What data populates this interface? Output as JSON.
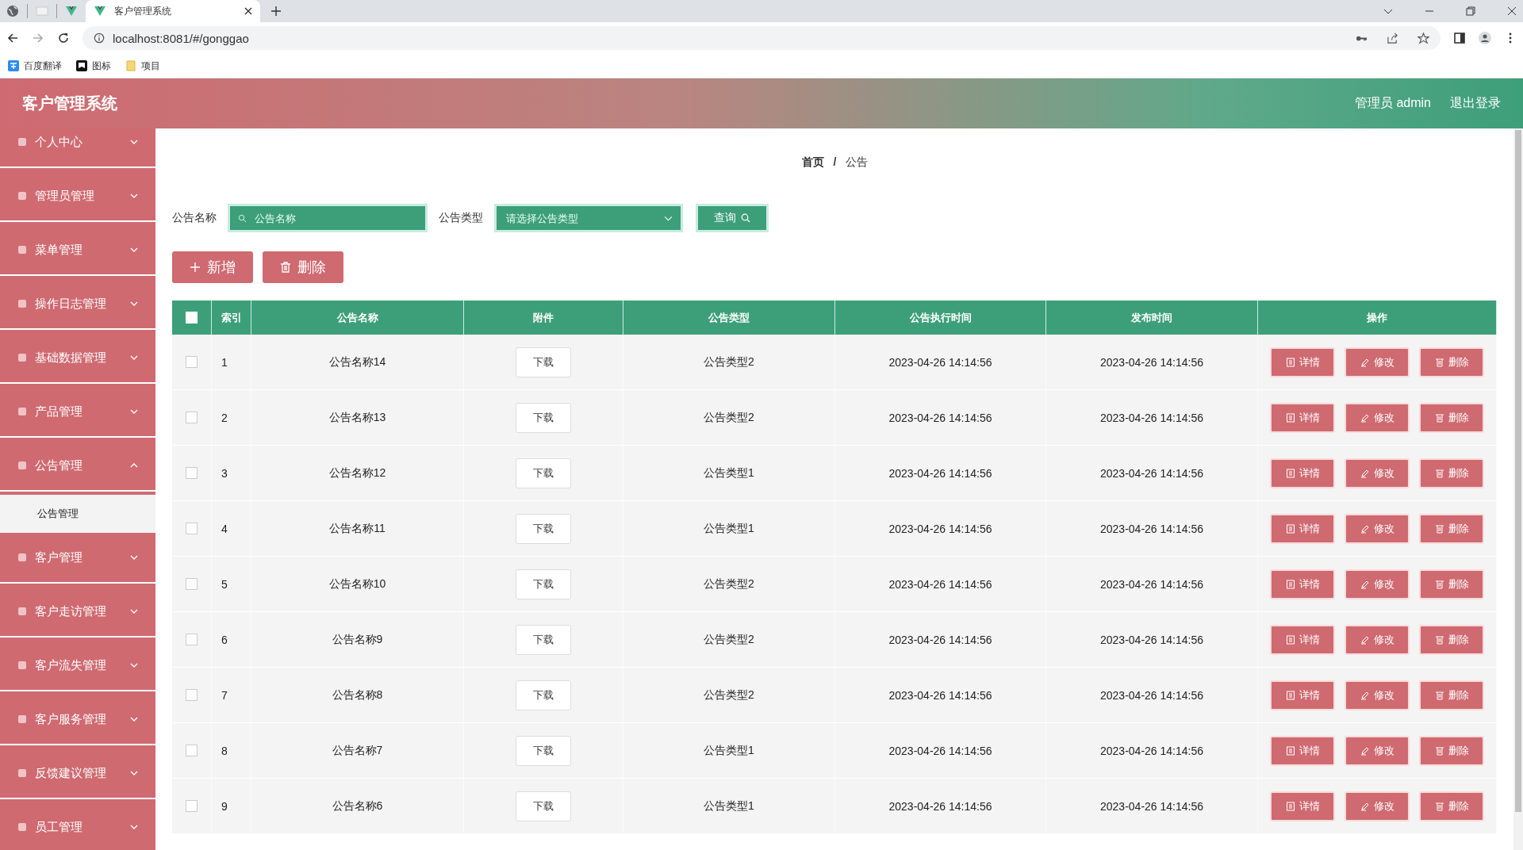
{
  "browser": {
    "tabs": [
      {
        "title": "客户管理系统",
        "selected": true
      }
    ],
    "url": "localhost:8081/#/gonggao",
    "bookmarks": [
      {
        "label": "百度翻译",
        "kind": "translate"
      },
      {
        "label": "图标",
        "kind": "flag"
      },
      {
        "label": "项目",
        "kind": "folder"
      }
    ]
  },
  "header": {
    "title": "客户管理系统",
    "user": "管理员 admin",
    "logout": "退出登录"
  },
  "sidebar": {
    "items": [
      {
        "label": "个人中心",
        "expanded": false
      },
      {
        "label": "管理员管理",
        "expanded": false
      },
      {
        "label": "菜单管理",
        "expanded": false
      },
      {
        "label": "操作日志管理",
        "expanded": false
      },
      {
        "label": "基础数据管理",
        "expanded": false
      },
      {
        "label": "产品管理",
        "expanded": false
      },
      {
        "label": "公告管理",
        "expanded": true,
        "children": [
          {
            "label": "公告管理",
            "selected": true
          }
        ]
      },
      {
        "label": "客户管理",
        "expanded": false
      },
      {
        "label": "客户走访管理",
        "expanded": false
      },
      {
        "label": "客户流失管理",
        "expanded": false
      },
      {
        "label": "客户服务管理",
        "expanded": false
      },
      {
        "label": "反馈建议管理",
        "expanded": false
      },
      {
        "label": "员工管理",
        "expanded": false
      }
    ]
  },
  "breadcrumb": {
    "items": [
      "首页",
      "公告"
    ],
    "separator": "/"
  },
  "search": {
    "fields": [
      {
        "label": "公告名称",
        "placeholder": "公告名称",
        "kind": "text"
      },
      {
        "label": "公告类型",
        "placeholder": "请选择公告类型",
        "kind": "select"
      }
    ],
    "button": "查询"
  },
  "actions": [
    {
      "label": "新增",
      "kind": "add"
    },
    {
      "label": "删除",
      "kind": "delete"
    }
  ],
  "table": {
    "columns": [
      "索引",
      "公告名称",
      "附件",
      "公告类型",
      "公告执行时间",
      "发布时间",
      "操作"
    ],
    "header_checked": false,
    "rows": [
      {
        "checked": false,
        "index": "1",
        "name": "公告名称14",
        "file": "下载",
        "type": "公告类型2",
        "exec": "2023-04-26 14:14:56",
        "pub": "2023-04-26 14:14:56",
        "ops": [
          "详情",
          "修改",
          "删除"
        ]
      },
      {
        "checked": false,
        "index": "2",
        "name": "公告名称13",
        "file": "下载",
        "type": "公告类型2",
        "exec": "2023-04-26 14:14:56",
        "pub": "2023-04-26 14:14:56",
        "ops": [
          "详情",
          "修改",
          "删除"
        ]
      },
      {
        "checked": false,
        "index": "3",
        "name": "公告名称12",
        "file": "下载",
        "type": "公告类型1",
        "exec": "2023-04-26 14:14:56",
        "pub": "2023-04-26 14:14:56",
        "ops": [
          "详情",
          "修改",
          "删除"
        ]
      },
      {
        "checked": false,
        "index": "4",
        "name": "公告名称11",
        "file": "下载",
        "type": "公告类型1",
        "exec": "2023-04-26 14:14:56",
        "pub": "2023-04-26 14:14:56",
        "ops": [
          "详情",
          "修改",
          "删除"
        ]
      },
      {
        "checked": false,
        "index": "5",
        "name": "公告名称10",
        "file": "下载",
        "type": "公告类型2",
        "exec": "2023-04-26 14:14:56",
        "pub": "2023-04-26 14:14:56",
        "ops": [
          "详情",
          "修改",
          "删除"
        ]
      },
      {
        "checked": false,
        "index": "6",
        "name": "公告名称9",
        "file": "下载",
        "type": "公告类型2",
        "exec": "2023-04-26 14:14:56",
        "pub": "2023-04-26 14:14:56",
        "ops": [
          "详情",
          "修改",
          "删除"
        ]
      },
      {
        "checked": false,
        "index": "7",
        "name": "公告名称8",
        "file": "下载",
        "type": "公告类型2",
        "exec": "2023-04-26 14:14:56",
        "pub": "2023-04-26 14:14:56",
        "ops": [
          "详情",
          "修改",
          "删除"
        ]
      },
      {
        "checked": false,
        "index": "8",
        "name": "公告名称7",
        "file": "下载",
        "type": "公告类型1",
        "exec": "2023-04-26 14:14:56",
        "pub": "2023-04-26 14:14:56",
        "ops": [
          "详情",
          "修改",
          "删除"
        ]
      },
      {
        "checked": false,
        "index": "9",
        "name": "公告名称6",
        "file": "下载",
        "type": "公告类型1",
        "exec": "2023-04-26 14:14:56",
        "pub": "2023-04-26 14:14:56",
        "ops": [
          "详情",
          "修改",
          "删除"
        ]
      }
    ]
  }
}
